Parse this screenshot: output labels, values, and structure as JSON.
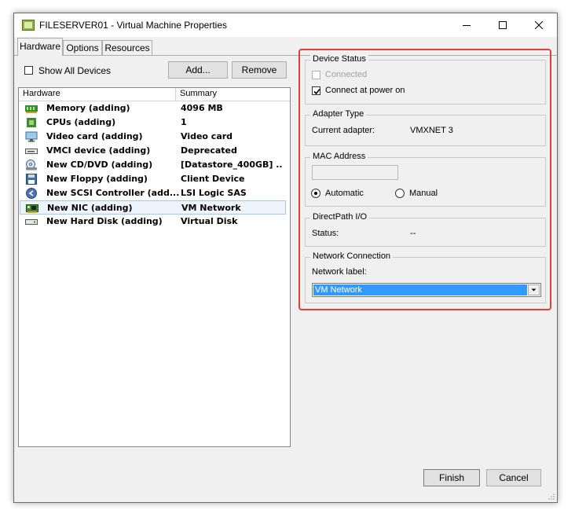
{
  "window": {
    "title": "FILESERVER01 - Virtual Machine Properties"
  },
  "tabs": [
    {
      "label": "Hardware",
      "active": true
    },
    {
      "label": "Options",
      "active": false
    },
    {
      "label": "Resources",
      "active": false
    }
  ],
  "hardware_panel": {
    "show_all_devices_label": "Show All Devices",
    "show_all_devices_checked": false,
    "add_button": "Add...",
    "remove_button": "Remove",
    "columns": [
      "Hardware",
      "Summary"
    ],
    "rows": [
      {
        "icon": "memory-icon",
        "name": "Memory (adding)",
        "summary": "4096 MB"
      },
      {
        "icon": "cpu-icon",
        "name": "CPUs (adding)",
        "summary": "1"
      },
      {
        "icon": "monitor-icon",
        "name": "Video card  (adding)",
        "summary": "Video card"
      },
      {
        "icon": "vmci-device-icon",
        "name": "VMCI device (adding)",
        "summary": "Deprecated"
      },
      {
        "icon": "cd-dvd-icon",
        "name": "New CD/DVD (adding)",
        "summary": "[Datastore_400GB] ..."
      },
      {
        "icon": "floppy-icon",
        "name": "New Floppy (adding)",
        "summary": "Client Device"
      },
      {
        "icon": "scsi-controller-icon",
        "name": "New SCSI Controller (add...",
        "summary": "LSI Logic SAS"
      },
      {
        "icon": "network-card-icon",
        "name": "New NIC (adding)",
        "summary": "VM Network",
        "selected": true
      },
      {
        "icon": "hard-disk-icon",
        "name": "New Hard Disk (adding)",
        "summary": "Virtual Disk"
      }
    ]
  },
  "device_status": {
    "label": "Device Status",
    "connected_label": "Connected",
    "connected_checked": false,
    "connected_enabled": false,
    "connect_at_power_on_label": "Connect at power on",
    "connect_at_power_on_checked": true
  },
  "adapter_type": {
    "label": "Adapter Type",
    "current_adapter_label": "Current adapter:",
    "current_adapter_value": "VMXNET 3"
  },
  "mac_address": {
    "label": "MAC Address",
    "value": "",
    "automatic_label": "Automatic",
    "manual_label": "Manual",
    "selected": "Automatic"
  },
  "directpath": {
    "label": "DirectPath I/O",
    "status_label": "Status:",
    "status_value": "--"
  },
  "network_connection": {
    "label": "Network Connection",
    "network_label_text": "Network label:",
    "selected_network": "VM Network"
  },
  "footer": {
    "finish_button": "Finish",
    "cancel_button": "Cancel"
  },
  "colors": {
    "highlight_frame": "#e0403a",
    "selection": "#3399ff"
  }
}
